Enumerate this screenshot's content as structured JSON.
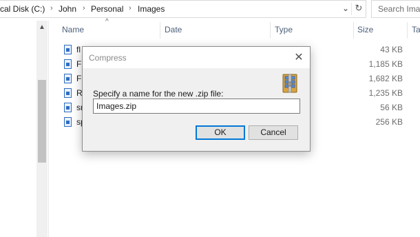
{
  "address_bar": {
    "crumbs": [
      "cal Disk (C:)",
      "John",
      "Personal",
      "Images"
    ],
    "separator": "›",
    "dropdown_glyph": "⌄",
    "refresh_glyph": "↻"
  },
  "search": {
    "placeholder": "Search Ima"
  },
  "nav": {
    "scroll_up_glyph": "▲"
  },
  "columns": {
    "name": "Name",
    "date": "Date",
    "type": "Type",
    "size": "Size",
    "tags": "Ta",
    "sort_glyph": "^"
  },
  "files": [
    {
      "name": "fl",
      "size": "43 KB"
    },
    {
      "name": "Fr",
      "size": "1,185 KB"
    },
    {
      "name": "Fr",
      "size": "1,682 KB"
    },
    {
      "name": "Re",
      "size": "1,235 KB"
    },
    {
      "name": "sn",
      "size": "56 KB"
    },
    {
      "name": "sp",
      "size": "256 KB"
    }
  ],
  "dialog": {
    "title": "Compress",
    "close_glyph": "✕",
    "icon": "zip-archive-icon",
    "prompt": "Specify a name for the new .zip file:",
    "filename_value": "Images.zip",
    "ok_label": "OK",
    "cancel_label": "Cancel"
  },
  "colors": {
    "accent": "#0078d7",
    "header_text": "#4c607a",
    "dialog_bg": "#f0f0f0"
  }
}
